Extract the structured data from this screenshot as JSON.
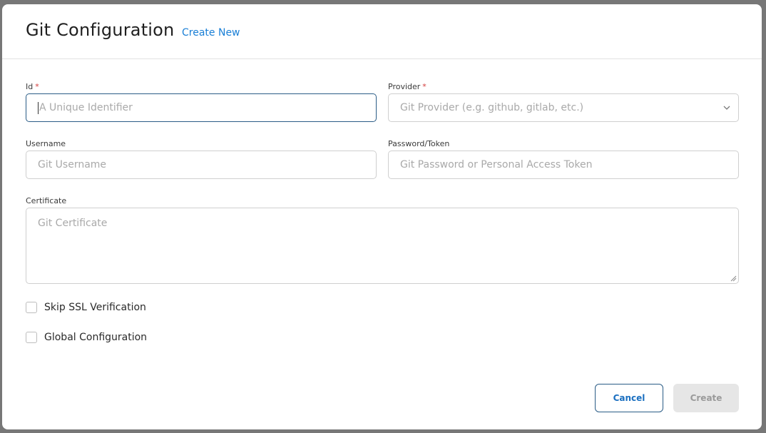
{
  "dialog": {
    "title": "Git Configuration",
    "create_new_link": "Create New"
  },
  "fields": {
    "id": {
      "label": "Id",
      "required_mark": "*",
      "placeholder": "A Unique Identifier"
    },
    "provider": {
      "label": "Provider",
      "required_mark": "*",
      "placeholder": "Git Provider (e.g. github, gitlab, etc.)"
    },
    "username": {
      "label": "Username",
      "placeholder": "Git Username"
    },
    "password": {
      "label": "Password/Token",
      "placeholder": "Git Password or Personal Access Token"
    },
    "certificate": {
      "label": "Certificate",
      "placeholder": "Git Certificate"
    }
  },
  "checkboxes": {
    "skip_ssl": {
      "label": "Skip SSL Verification",
      "checked": false
    },
    "global_config": {
      "label": "Global Configuration",
      "checked": false
    }
  },
  "actions": {
    "cancel_label": "Cancel",
    "create_label": "Create"
  },
  "icons": {
    "provider_dropdown": "chevron-down-icon",
    "certificate_resize": "resize-grip-icon"
  },
  "colors": {
    "link": "#1a7fd6",
    "focus_border": "#2a5c86",
    "required": "#d23a3a",
    "disabled_button_bg": "#e6e6e6"
  }
}
